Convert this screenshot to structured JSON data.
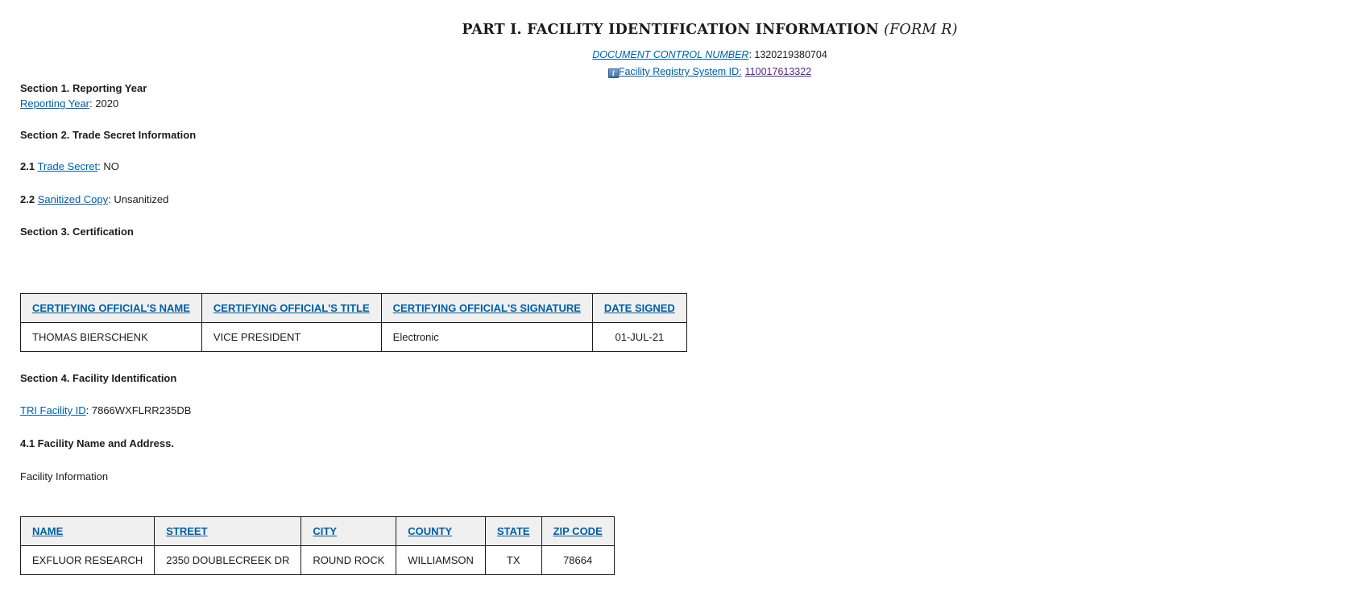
{
  "header": {
    "title": "PART I. FACILITY IDENTIFICATION INFORMATION",
    "form_tag": "(FORM R)",
    "document_control_label": "DOCUMENT CONTROL NUMBER",
    "document_control_number": "1320219380704",
    "frs_icon": "info-icon",
    "frs_label": "Facility Registry System ID:",
    "frs_id": "110017613322"
  },
  "section1": {
    "heading": "Section 1. Reporting Year",
    "reporting_year_label": "Reporting Year",
    "reporting_year_value": "2020"
  },
  "section2": {
    "heading": "Section 2. Trade Secret Information",
    "item_2_1_number": "2.1",
    "trade_secret_label": "Trade Secret",
    "trade_secret_value": "NO",
    "item_2_2_number": "2.2",
    "sanitized_label": "Sanitized Copy",
    "sanitized_value": "Unsanitized"
  },
  "section3": {
    "heading": "Section 3. Certification",
    "table": {
      "headers": [
        "CERTIFYING OFFICIAL'S NAME",
        "CERTIFYING OFFICIAL'S TITLE",
        "CERTIFYING OFFICIAL'S SIGNATURE",
        "DATE SIGNED"
      ],
      "rows": [
        [
          "THOMAS BIERSCHENK",
          "VICE PRESIDENT",
          "Electronic",
          "01-JUL-21"
        ]
      ]
    }
  },
  "section4": {
    "heading": "Section 4. Facility Identification",
    "tri_id_label": "TRI Facility ID",
    "tri_id_value": "7866WXFLRR235DB",
    "subheading": "4.1 Facility Name and Address.",
    "facility_info_label": "Facility Information",
    "table": {
      "headers": [
        "NAME",
        "STREET",
        "CITY",
        "COUNTY",
        "STATE",
        "ZIP CODE"
      ],
      "rows": [
        [
          "EXFLUOR RESEARCH",
          "2350 DOUBLECREEK DR",
          "ROUND ROCK",
          "WILLIAMSON",
          "TX",
          "78664"
        ]
      ]
    }
  }
}
